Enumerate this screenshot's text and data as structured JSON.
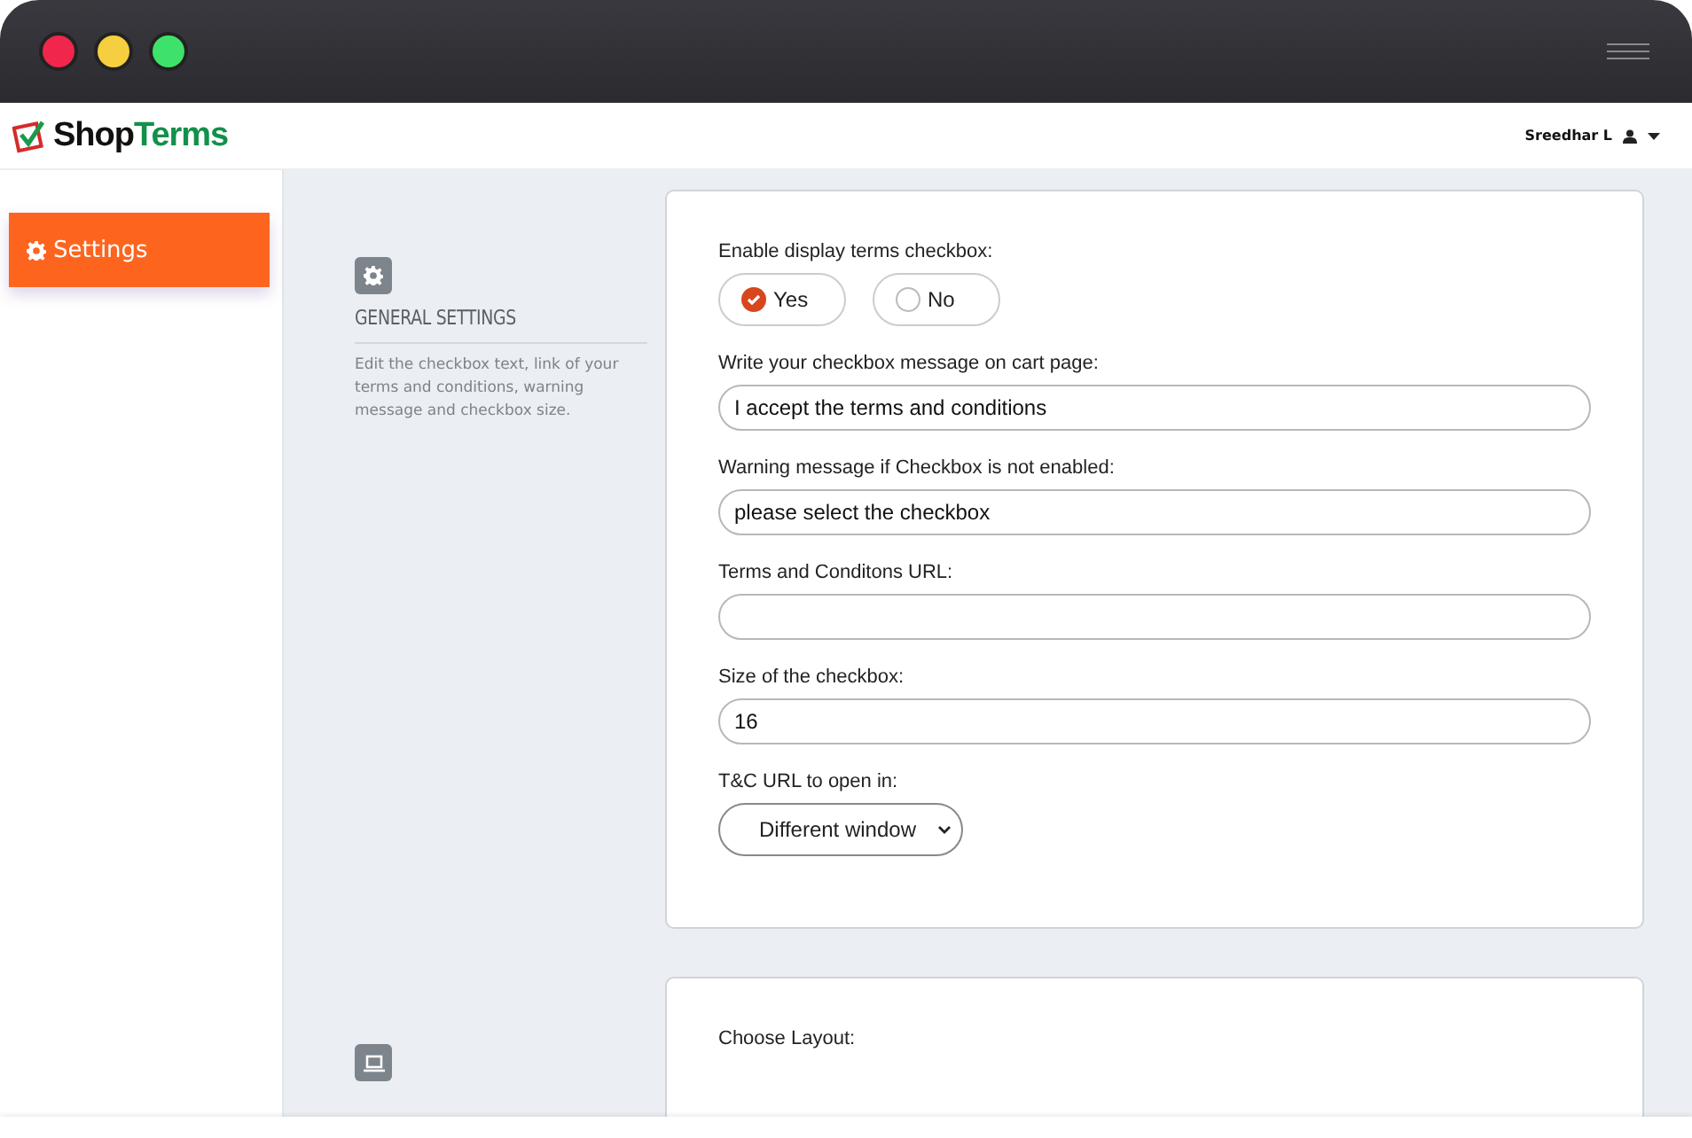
{
  "brand": {
    "part_1": "Shop",
    "part_2": "Terms"
  },
  "user": {
    "name": "Sreedhar L"
  },
  "sidebar": {
    "items": [
      {
        "label": "Settings",
        "selected": true
      }
    ]
  },
  "sections": [
    {
      "title": "GENERAL SETTINGS",
      "description": "Edit the checkbox text, link of your terms and conditions, warning message and checkbox size.",
      "fields": [
        {
          "kind": "radio",
          "label": "Enable display terms checkbox:",
          "options": [
            {
              "label": "Yes",
              "selected": true
            },
            {
              "label": "No",
              "selected": false
            }
          ]
        },
        {
          "kind": "text",
          "label": "Write your checkbox message on cart page:",
          "value": "I accept the terms and conditions"
        },
        {
          "kind": "text",
          "label": "Warning message if Checkbox is not enabled:",
          "value": "please select the checkbox"
        },
        {
          "kind": "text",
          "label": "Terms and Conditons URL:"
        },
        {
          "kind": "text",
          "label": "Size of the checkbox:",
          "value": "16"
        },
        {
          "kind": "select",
          "label": "T&C URL to open in:",
          "value": "Different window"
        }
      ]
    },
    {
      "fields": [
        {
          "kind": "radio",
          "label": "Choose Layout:"
        }
      ]
    }
  ]
}
